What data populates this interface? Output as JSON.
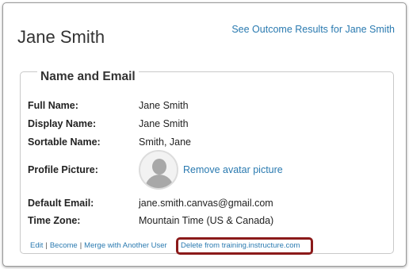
{
  "header": {
    "user_name": "Jane Smith",
    "outcome_link": "See Outcome Results for Jane Smith"
  },
  "section": {
    "title": "Name and Email",
    "fields": {
      "full_name": {
        "label": "Full Name:",
        "value": "Jane Smith"
      },
      "display_name": {
        "label": "Display Name:",
        "value": "Jane Smith"
      },
      "sortable_name": {
        "label": "Sortable Name:",
        "value": "Smith, Jane"
      },
      "profile_picture": {
        "label": "Profile Picture:",
        "action": "Remove avatar picture"
      },
      "default_email": {
        "label": "Default Email:",
        "value": "jane.smith.canvas@gmail.com"
      },
      "time_zone": {
        "label": "Time Zone:",
        "value": "Mountain Time (US & Canada)"
      }
    }
  },
  "actions": {
    "edit": "Edit",
    "become": "Become",
    "merge": "Merge with Another User",
    "delete": "Delete from training.instructure.com",
    "separator": "|"
  },
  "colors": {
    "link": "#2a7ab0",
    "highlight": "#8b1a1a"
  }
}
